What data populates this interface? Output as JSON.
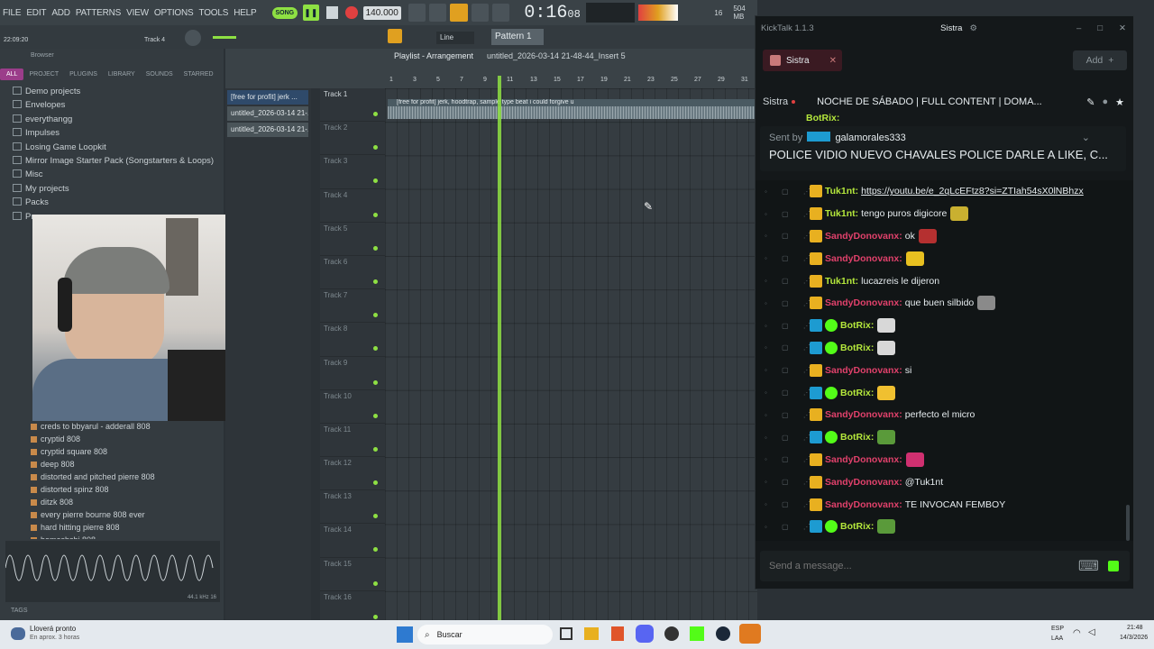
{
  "fl": {
    "menus": [
      "FILE",
      "EDIT",
      "ADD",
      "PATTERNS",
      "VIEW",
      "OPTIONS",
      "TOOLS",
      "HELP"
    ],
    "song_toggle": "SONG",
    "tempo": "140.000",
    "time": "0:16",
    "time_sub": "08",
    "time_label": "M:S:CS",
    "cpu": "16",
    "memory": "504 MB",
    "mem_sub": "1",
    "clock_small": "22:09:20",
    "hint_track": "Track 4",
    "pattern_select": "Pattern 1",
    "snap": "Line",
    "browser_title": "Browser",
    "browser_tabs": [
      "ALL",
      "PROJECT",
      "PLUGINS",
      "LIBRARY",
      "SOUNDS",
      "STARRED"
    ],
    "tree_items": [
      "Demo projects",
      "Envelopes",
      "everythangg",
      "Impulses",
      "Losing Game Loopkit",
      "Mirror Image Starter Pack (Songstarters & Loops)",
      "Misc",
      "My projects",
      "Packs",
      "Pr..."
    ],
    "file_items": [
      "creds to bbyarul - adderall 808",
      "cryptid 808",
      "cryptid square 808",
      "deep 808",
      "distorted and pitched pierre 808",
      "distorted spinz 808",
      "ditzk 808",
      "every pierre bourne 808 ever",
      "hard hitting pierre 808",
      "homeshshi 808"
    ],
    "waveform_info": "44.1 kHz 16",
    "tags": "TAGS",
    "playlist_title": "Playlist - Arrangement",
    "playlist_file": "untitled_2026-03-14 21-48-44_Insert 5",
    "patterns": [
      "[free for profit] jerk ...",
      "untitled_2026-03-14 21-...",
      "untitled_2026-03-14 21-..."
    ],
    "clip_label": "[free for profit] jerk, hoodtrap, sample type beat i could forgive u",
    "ruler": [
      "1",
      "3",
      "5",
      "7",
      "9",
      "11",
      "13",
      "15",
      "17",
      "19",
      "21",
      "23",
      "25",
      "27",
      "29",
      "31"
    ],
    "tracks": [
      "Track 1",
      "Track 2",
      "Track 3",
      "Track 4",
      "Track 5",
      "Track 6",
      "Track 7",
      "Track 8",
      "Track 9",
      "Track 10",
      "Track 11",
      "Track 12",
      "Track 13",
      "Track 14",
      "Track 15",
      "Track 16"
    ]
  },
  "kicktalk": {
    "app_title": "KickTalk 1.1.3",
    "user": "Sistra",
    "chat_tab": "Sistra",
    "add_button": "Add",
    "channel_name": "Sistra",
    "stream_title": "NOCHE DE SÁBADO | FULL CONTENT | DOMA...",
    "pinned_sent_by": "Sent by",
    "pinned_user": "galamorales333",
    "pinned_text": "POLICE VIDIO NUEVO CHAVALES POLICE DARLE A LIKE, C...",
    "top_cut_user": "BotRix:",
    "messages": [
      {
        "user": "Tuk1nt:",
        "cls": "u-tuk",
        "text": "https://youtu.be/e_2qLcEFtz8?si=ZTIah54sX0lNBhzx",
        "link": true,
        "emote": ""
      },
      {
        "user": "Tuk1nt:",
        "cls": "u-tuk",
        "text": "tengo puros digicore",
        "emote": "#c9b030"
      },
      {
        "user": "SandyDonovanx:",
        "cls": "u-sandy",
        "text": "ok",
        "emote": "#b53030"
      },
      {
        "user": "SandyDonovanx:",
        "cls": "u-sandy",
        "text": "",
        "emote": "#e8c020"
      },
      {
        "user": "Tuk1nt:",
        "cls": "u-tuk",
        "text": "lucazreis le dijeron",
        "emote": ""
      },
      {
        "user": "SandyDonovanx:",
        "cls": "u-sandy",
        "text": "que buen silbido",
        "emote": "#8a8a8a"
      },
      {
        "user": "BotRix:",
        "cls": "u-bot",
        "text": "",
        "emote": "#d8d8d8"
      },
      {
        "user": "BotRix:",
        "cls": "u-bot",
        "text": "",
        "emote": "#d8d8d8"
      },
      {
        "user": "SandyDonovanx:",
        "cls": "u-sandy",
        "text": "si",
        "emote": ""
      },
      {
        "user": "BotRix:",
        "cls": "u-bot",
        "text": "",
        "emote": "#f0c030"
      },
      {
        "user": "SandyDonovanx:",
        "cls": "u-sandy",
        "text": "perfecto el micro",
        "emote": ""
      },
      {
        "user": "BotRix:",
        "cls": "u-bot",
        "text": "",
        "emote": "#5a9a3a"
      },
      {
        "user": "SandyDonovanx:",
        "cls": "u-sandy",
        "text": "",
        "emote": "#d03070"
      },
      {
        "user": "SandyDonovanx:",
        "cls": "u-sandy",
        "text": "@Tuk1nt",
        "emote": ""
      },
      {
        "user": "SandyDonovanx:",
        "cls": "u-sandy",
        "text": "TE INVOCAN FEMBOY",
        "emote": ""
      },
      {
        "user": "BotRix:",
        "cls": "u-bot",
        "text": "",
        "emote": "#5a9a3a"
      }
    ],
    "input_placeholder": "Send a message..."
  },
  "taskbar": {
    "weather_title": "Lloverá pronto",
    "weather_sub": "En aprox. 3 horas",
    "search_placeholder": "Buscar",
    "lang": "ESP",
    "lang_sub": "LAA",
    "clock_time": "21:48",
    "clock_date": "14/3/2026"
  },
  "colors": {
    "accent_green": "#8ee043",
    "kick_green": "#53fc18",
    "sandy": "#e0416b",
    "tuk": "#b5e83c",
    "tab_pink": "#9b3d8a"
  }
}
